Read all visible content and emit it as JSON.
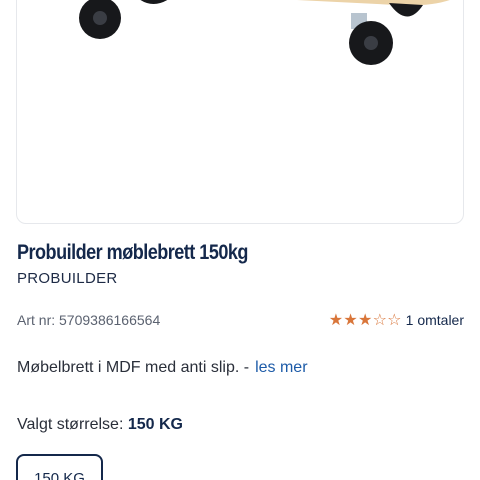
{
  "product": {
    "title": "Probuilder møblebrett 150kg",
    "brand": "PROBUILDER",
    "art_nr_label": "Art nr:",
    "art_nr_value": "5709386166564",
    "rating": {
      "stars_filled": 3,
      "stars_total": 5,
      "review_count_text": "1 omtaler",
      "color": "#d9763a"
    },
    "description": "Møbelbrett i MDF med anti slip. -",
    "read_more_label": "les mer",
    "selected_size_label": "Valgt størrelse:",
    "selected_size_value": "150 KG",
    "size_options": [
      "150 KG"
    ]
  },
  "colors": {
    "primary": "#14284b",
    "link": "#1d5ba8",
    "board": "#ecd3a8"
  }
}
